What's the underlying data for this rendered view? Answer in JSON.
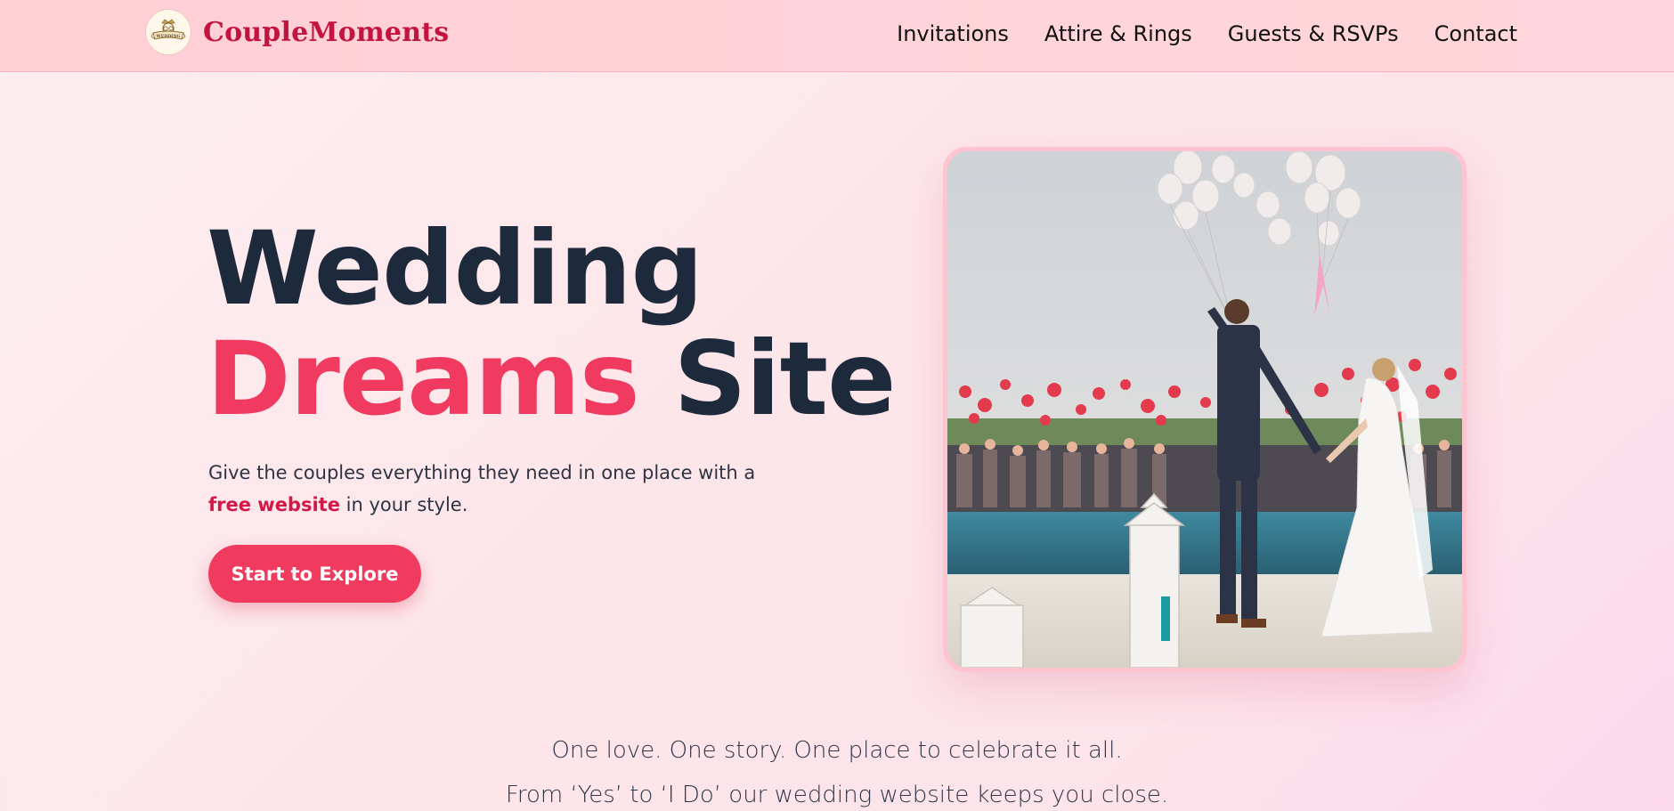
{
  "brand": {
    "name": "CoupleMoments",
    "logo_text": "WEDDING",
    "logo_icon": "wedding-crest-icon"
  },
  "nav": {
    "items": [
      {
        "label": "Invitations"
      },
      {
        "label": "Attire & Rings"
      },
      {
        "label": "Guests & RSVPs"
      },
      {
        "label": "Contact"
      }
    ]
  },
  "hero": {
    "title_line1": "Wedding",
    "title_accent": "Dreams",
    "title_rest": " Site",
    "description_before": "Give the couples everything they need in one place with a ",
    "description_highlight": "free website",
    "description_after": " in your style.",
    "cta_label": "Start to Explore",
    "image_alt": "Bride and groom holding hands by a pool as guests release pink and red balloons"
  },
  "tagline": {
    "line1": "One love. One story. One place to celebrate it all.",
    "line2": "From ‘Yes’ to ‘I Do’ our wedding website keeps you close."
  },
  "colors": {
    "accent": "#f03a5e",
    "brand": "#c2143f",
    "heading": "#1d2a3c",
    "header_bg": "#ffd1d7"
  }
}
